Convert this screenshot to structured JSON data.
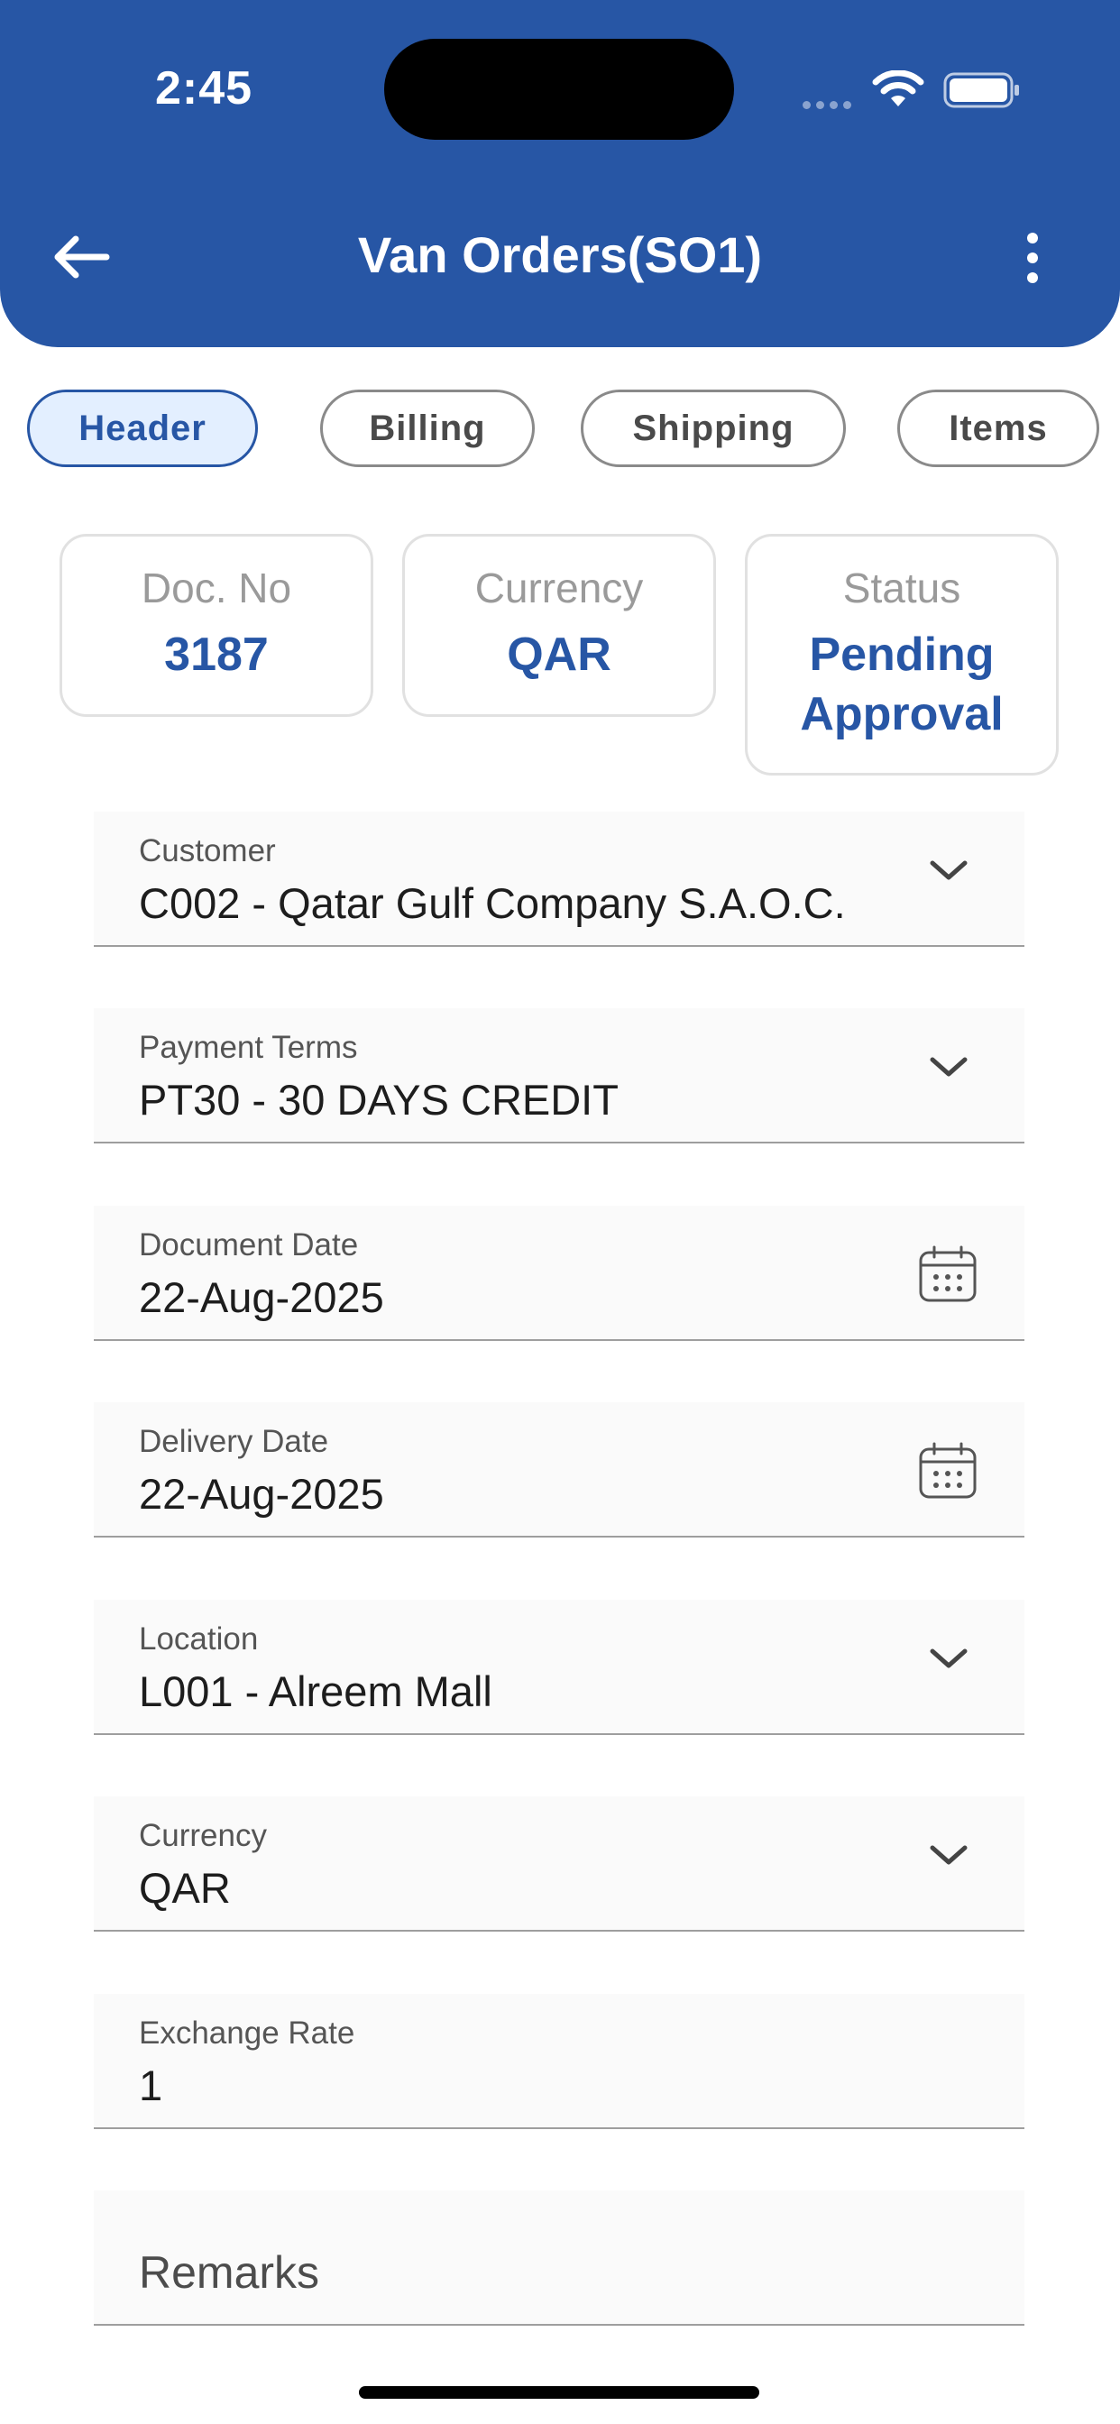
{
  "status_bar": {
    "time": "2:45"
  },
  "app_bar": {
    "title": "Van Orders(SO1)",
    "back_icon": "arrow-left-icon",
    "menu_icon": "more-vertical-icon"
  },
  "tabs": [
    {
      "label": "Header",
      "active": true
    },
    {
      "label": "Billing",
      "active": false
    },
    {
      "label": "Shipping",
      "active": false
    },
    {
      "label": "Items",
      "active": false
    }
  ],
  "summary": {
    "doc_no": {
      "label": "Doc. No",
      "value": "3187"
    },
    "currency": {
      "label": "Currency",
      "value": "QAR"
    },
    "status": {
      "label": "Status",
      "value_line1": "Pending",
      "value_line2": "Approval"
    }
  },
  "form": {
    "customer": {
      "label": "Customer",
      "value": "C002 - Qatar Gulf Company S.A.O.C."
    },
    "payment_terms": {
      "label": "Payment Terms",
      "value": "PT30 - 30 DAYS CREDIT"
    },
    "document_date": {
      "label": "Document Date",
      "value": "22-Aug-2025"
    },
    "delivery_date": {
      "label": "Delivery Date",
      "value": "22-Aug-2025"
    },
    "location": {
      "label": "Location",
      "value": "L001 - Alreem Mall"
    },
    "currency": {
      "label": "Currency",
      "value": "QAR"
    },
    "exchange_rate": {
      "label": "Exchange Rate",
      "value": "1"
    },
    "remarks": {
      "placeholder": "Remarks"
    }
  },
  "colors": {
    "primary": "#2756a5",
    "active_tab_bg": "#e3efff"
  }
}
